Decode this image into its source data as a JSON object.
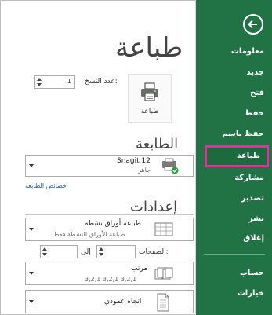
{
  "nav": {
    "back_label": "",
    "items": [
      {
        "label": "معلومات"
      },
      {
        "label": "جديد"
      },
      {
        "label": "فتح"
      },
      {
        "label": "حفظ"
      },
      {
        "label": "حفظ باسم"
      },
      {
        "label": "طباعة"
      },
      {
        "label": "مشاركة"
      },
      {
        "label": "تصدير"
      },
      {
        "label": "نشر"
      },
      {
        "label": "إغلاق"
      },
      {
        "label": "حساب"
      },
      {
        "label": "خيارات"
      }
    ],
    "active_index": 5,
    "colors": {
      "background": "#217346",
      "highlight_border": "#e0339a"
    }
  },
  "print": {
    "title": "طباعة",
    "copies_label": "عدد النسخ:",
    "copies_value": "1",
    "button_label": "طباعة",
    "button_icon": "printer-icon"
  },
  "printer": {
    "section_title": "الطابعة",
    "name": "Snagit 12",
    "status": "جاهز",
    "icon": "printer-ready-icon",
    "properties_link": "خصائص الطابعة"
  },
  "settings": {
    "section_title": "إعدادات",
    "what_to_print": {
      "main": "طباعة أوراق نشطة",
      "sub": "طباعة الأوراق النشطة فقط",
      "icon": "sheet-grid-icon"
    },
    "pages": {
      "label": "الصفحات:",
      "to_label": "إلى",
      "from": "",
      "to": ""
    },
    "collation": {
      "main": "مرتب",
      "sub": "3,2,1   3,2,1   3,2,1",
      "icon": "collated-pages-icon"
    },
    "orientation": {
      "main": "اتجاه عمودي",
      "icon": "portrait-page-icon"
    }
  }
}
